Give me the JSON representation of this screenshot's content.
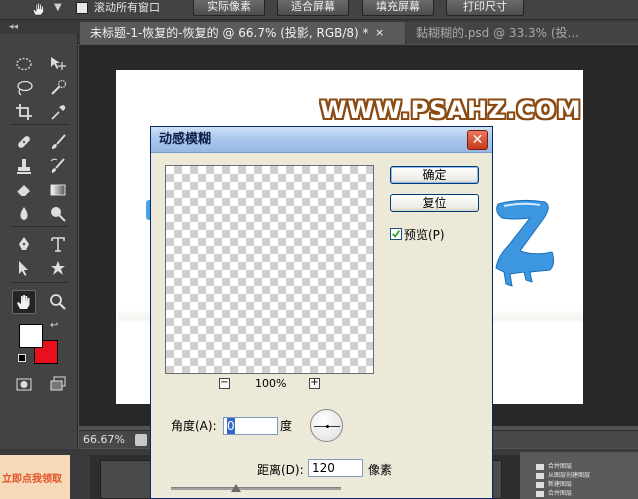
{
  "options_bar": {
    "tool_icon": "hand-icon",
    "scroll_all_label": "滚动所有窗口",
    "buttons": [
      "实际像素",
      "适合屏幕",
      "填充屏幕",
      "打印尺寸"
    ]
  },
  "tabs": [
    {
      "label": "未标题-1-恢复的-恢复的 @ 66.7% (投影, RGB/8) *",
      "close": "×"
    },
    {
      "label": "黏糊糊的.psd @ 33.3% (投...",
      "close": "×"
    }
  ],
  "tools_panel": {
    "grip": "◂◂",
    "tools": [
      "elliptical-marquee",
      "move",
      "lasso",
      "quick-selection",
      "crop",
      "eyedropper",
      "spot-healing",
      "brush",
      "clone-stamp",
      "history-brush",
      "eraser",
      "gradient",
      "blur",
      "dodge",
      "pen",
      "type",
      "path-selection",
      "custom-shape",
      "hand",
      "zoom"
    ],
    "selected_tool": "hand",
    "foreground_color": "#ffffff",
    "background_color": "#e8101c"
  },
  "document": {
    "watermark": "WWW.PSAHZ.COM",
    "status_zoom": "66.67%"
  },
  "dialog": {
    "title": "动感模糊",
    "close": "✕",
    "ok_label": "确定",
    "reset_label": "复位",
    "preview_label": "预览(P)",
    "preview_checked": true,
    "zoom_minus": "−",
    "zoom_plus": "+",
    "zoom_value": "100%",
    "angle_label": "角度(A):",
    "angle_value": "0",
    "angle_unit": "度",
    "distance_label": "距离(D):",
    "distance_value": "120",
    "distance_unit": "像素"
  },
  "bottom": {
    "ad_text": "立即点我领取",
    "layers": [
      "合并图层",
      "从图层创建图层",
      "新建图层",
      "合并图层"
    ]
  }
}
